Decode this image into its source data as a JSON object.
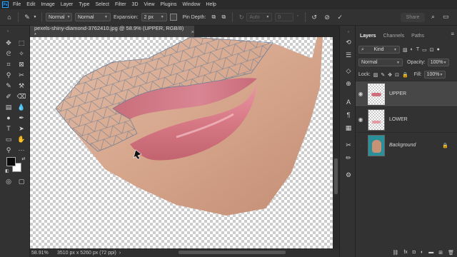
{
  "menu": {
    "logo": "Ps",
    "items": [
      "File",
      "Edit",
      "Image",
      "Layer",
      "Type",
      "Select",
      "Filter",
      "3D",
      "View",
      "Plugins",
      "Window",
      "Help"
    ]
  },
  "options": {
    "mode1": "Normal",
    "mode2": "Normal",
    "expansion_label": "Expansion:",
    "expansion_value": "2 px",
    "pin_depth_label": "Pin Depth:",
    "rotate_value": "Auto",
    "angle_value": "0",
    "angle_unit": "°",
    "share_label": "Share"
  },
  "document": {
    "tab_title": "pexels-shiny-diamond-3762410.jpg @ 58.9% (UPPER, RGB/8) *",
    "close": "×"
  },
  "status": {
    "zoom": "58.91%",
    "info": "3510 px x 5260 px (72 ppi)",
    "arrow": "›"
  },
  "layers_panel": {
    "tabs": [
      "Layers",
      "Channels",
      "Paths"
    ],
    "filter_value": "Kind",
    "blend_mode": "Normal",
    "opacity_label": "Opacity:",
    "opacity_value": "100%",
    "lock_label": "Lock:",
    "fill_label": "Fill:",
    "fill_value": "100%",
    "layers": [
      {
        "name": "UPPER",
        "visible": true,
        "selected": true
      },
      {
        "name": "LOWER",
        "visible": true,
        "selected": false
      },
      {
        "name": "Background",
        "visible": false,
        "selected": false,
        "locked": true
      }
    ]
  },
  "colors": {
    "foreground": "#0b0b0b",
    "background": "#ffffff",
    "skin": "#d4a58e",
    "lip": "#cf6f7d",
    "mesh": "#6f7f95"
  }
}
